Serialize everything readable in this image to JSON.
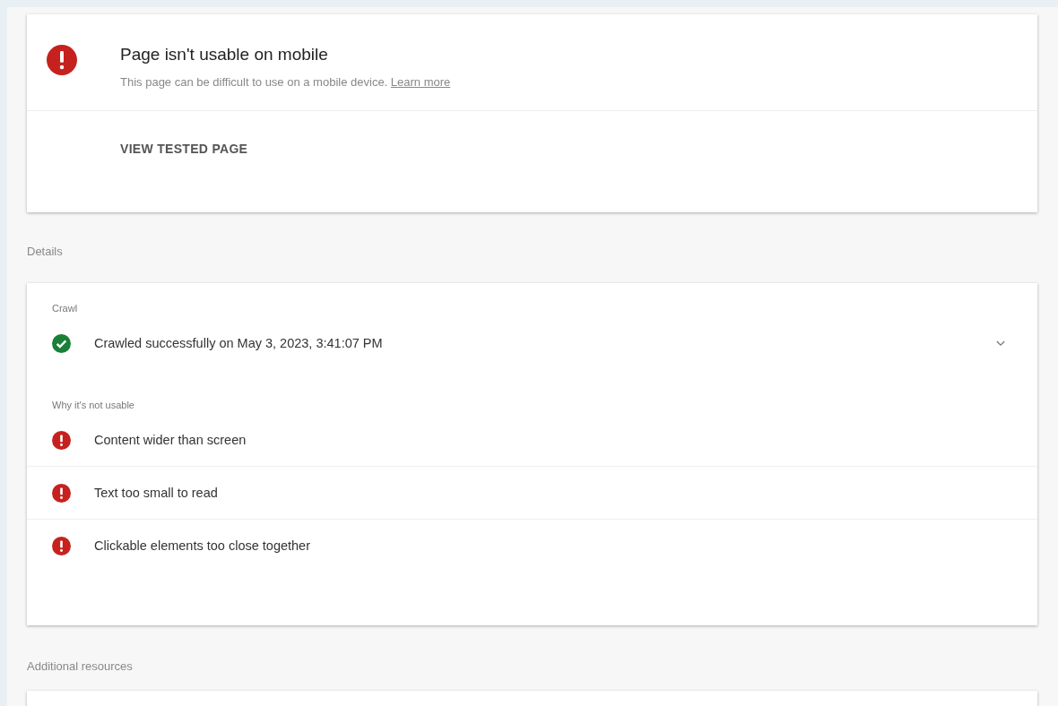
{
  "summary": {
    "usable": false,
    "title": "Page isn't usable on mobile",
    "description": "This page can be difficult to use on a mobile device.",
    "link": "Learn more",
    "action": "VIEW TESTED PAGE"
  },
  "details": {
    "heading": "Details",
    "sections": [
      {
        "label": "Crawl",
        "items": [
          {
            "kind": "success",
            "text": "Crawled successfully on May 3, 2023, 3:41:07 PM",
            "expanded": false
          }
        ]
      },
      {
        "label": "Why it's not usable",
        "items": [
          {
            "kind": "error",
            "text": "Content wider than screen"
          },
          {
            "kind": "error",
            "text": "Text too small to read"
          },
          {
            "kind": "error",
            "text": "Clickable elements too close together"
          }
        ]
      }
    ]
  },
  "additional": {
    "heading": "Additional resources"
  }
}
